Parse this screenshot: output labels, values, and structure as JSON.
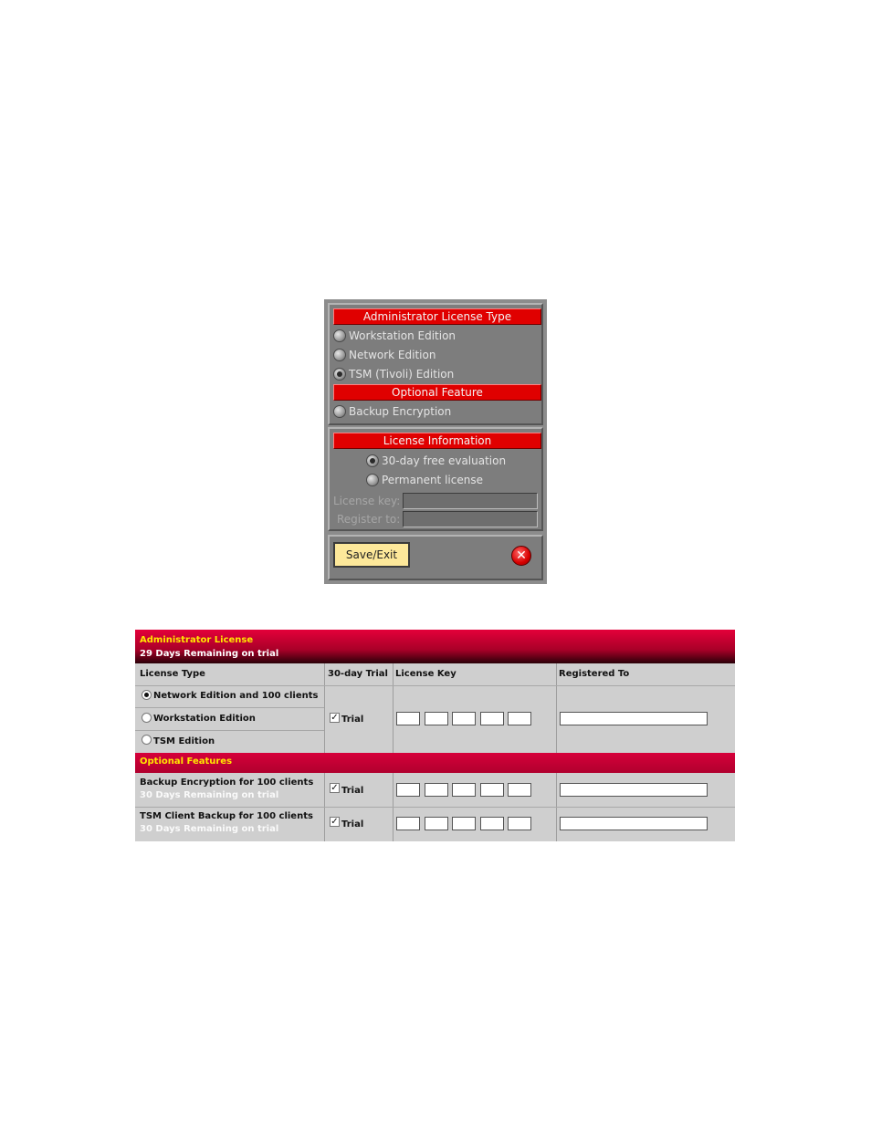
{
  "dialog": {
    "admin_license_title": "Administrator License Type",
    "editions": [
      {
        "label": "Workstation Edition",
        "selected": false
      },
      {
        "label": "Network Edition",
        "selected": false
      },
      {
        "label": "TSM (Tivoli) Edition",
        "selected": true
      }
    ],
    "optional_feature_title": "Optional Feature",
    "optional_features": [
      {
        "label": "Backup Encryption",
        "selected": false
      }
    ],
    "license_info_title": "License Information",
    "license_modes": [
      {
        "label": "30-day free evaluation",
        "selected": true
      },
      {
        "label": "Permanent license",
        "selected": false
      }
    ],
    "license_key_label": "License key:",
    "license_key_value": "",
    "register_to_label": "Register to:",
    "register_to_value": "",
    "save_label": "Save/Exit",
    "close_glyph": "✕",
    "close_icon": "close-circle-icon"
  },
  "panel": {
    "title": "Administrator License",
    "remaining": "29 Days Remaining on trial",
    "columns": [
      "License Type",
      "30-day Trial",
      "License Key",
      "Registered To"
    ],
    "license_types": [
      {
        "label": "Network Edition and 100 clients",
        "selected": true
      },
      {
        "label": "Workstation Edition",
        "selected": false
      },
      {
        "label": "TSM Edition",
        "selected": false
      }
    ],
    "trial_label": "Trial",
    "trial_checked": true,
    "optional_features_title": "Optional Features",
    "features": [
      {
        "name": "Backup Encryption for 100 clients",
        "remaining": "30 Days Remaining on trial",
        "trial_checked": true
      },
      {
        "name": "TSM Client Backup for 100 clients",
        "remaining": "30 Days Remaining on trial",
        "trial_checked": true
      }
    ],
    "colors": {
      "header_red": "#c8002e",
      "header_text": "#ffe600",
      "dialog_red": "#e00000",
      "dialog_gray": "#8c8c8c",
      "save_yellow": "#fde89a"
    }
  }
}
